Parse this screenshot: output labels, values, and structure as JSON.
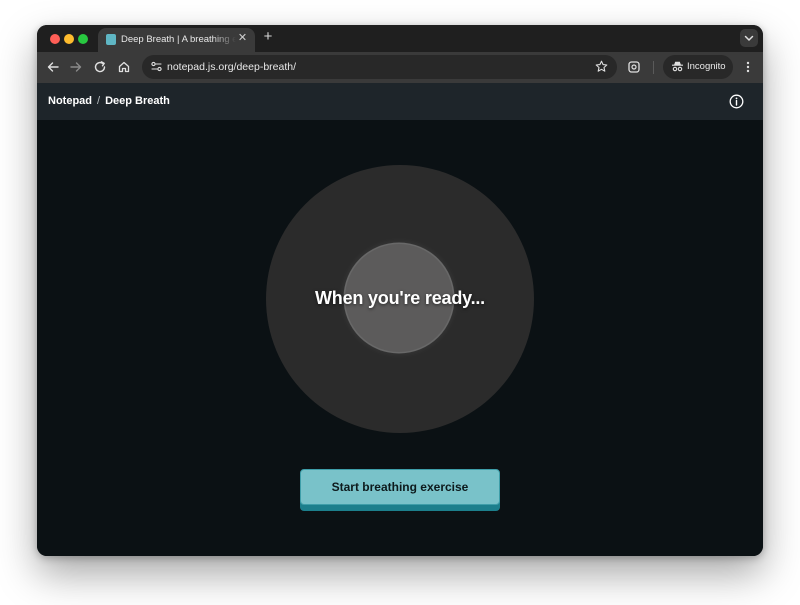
{
  "browser": {
    "tab_title": "Deep Breath | A breathing exercise",
    "url": "notepad.js.org/deep-breath/",
    "incognito_label": "Incognito",
    "new_tab_icon": "plus-icon",
    "close_tab_icon": "close-icon"
  },
  "app": {
    "breadcrumb_root": "Notepad",
    "breadcrumb_separator": "/",
    "breadcrumb_current": "Deep Breath"
  },
  "exercise": {
    "prompt": "When you're ready...",
    "start_button_label": "Start breathing exercise"
  },
  "colors": {
    "accent": "#79c2c9",
    "background": "#0b1114",
    "header": "#1e252a"
  }
}
